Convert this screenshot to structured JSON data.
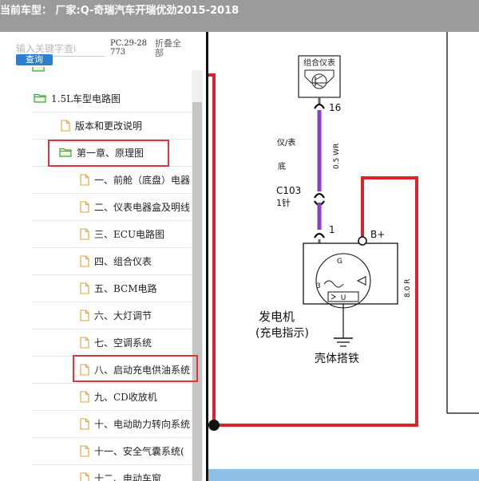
{
  "header": {
    "title": "当前车型： 厂家:Q-奇瑞汽车开瑞优劲2015-2018"
  },
  "search": {
    "placeholder": "输入关键字查i",
    "button": "查询",
    "pc_code": "PC.29-28773",
    "collapse_all": "折叠全部"
  },
  "tree": {
    "items": [
      {
        "label": "1.5L车型电路图",
        "icon": "folder-open-icon",
        "level": 1
      },
      {
        "label": "版本和更改说明",
        "icon": "file-icon",
        "level": 2
      },
      {
        "label": "第一章、原理图",
        "icon": "folder-open-icon",
        "level": 2
      },
      {
        "label": "一、前舱（底盘）电器",
        "icon": "file-icon",
        "level": 3
      },
      {
        "label": "二、仪表电器盒及明线",
        "icon": "file-icon",
        "level": 3
      },
      {
        "label": "三、ECU电路图",
        "icon": "file-icon",
        "level": 3
      },
      {
        "label": "四、组合仪表",
        "icon": "file-icon",
        "level": 3
      },
      {
        "label": "五、BCM电路",
        "icon": "file-icon",
        "level": 3
      },
      {
        "label": "六、大灯调节",
        "icon": "file-icon",
        "level": 3
      },
      {
        "label": "七、空调系统",
        "icon": "file-icon",
        "level": 3
      },
      {
        "label": "八、启动充电供油系统",
        "icon": "file-icon",
        "level": 3
      },
      {
        "label": "九、CD收放机",
        "icon": "file-icon",
        "level": 3
      },
      {
        "label": "十、电动助力转向系统",
        "icon": "file-icon",
        "level": 3
      },
      {
        "label": "十一、安全气囊系统(",
        "icon": "file-icon",
        "level": 3
      },
      {
        "label": "十二、电动车窗",
        "icon": "file-icon",
        "level": 3
      }
    ]
  },
  "diagram": {
    "cluster_label": "组合仪表",
    "pin_top": "16",
    "pin_bottom": "1",
    "connector_side": "仪/表",
    "connector_line3": "底",
    "connector_id": "C103",
    "connector_pin": "1针",
    "wire_spec_purple": "0.5 WR",
    "wire_spec_red": "8.0 R",
    "bplus": "B+",
    "alt_g": "G",
    "alt_3": "3",
    "alt_u": "U",
    "alternator_name": "发电机",
    "alternator_desc": "(充电指示)",
    "ground_label": "壳体搭铁",
    "colors": {
      "purple_wire": "#8b3fc4",
      "red_wire": "#d9232e",
      "highlight": "#d9383e"
    }
  }
}
